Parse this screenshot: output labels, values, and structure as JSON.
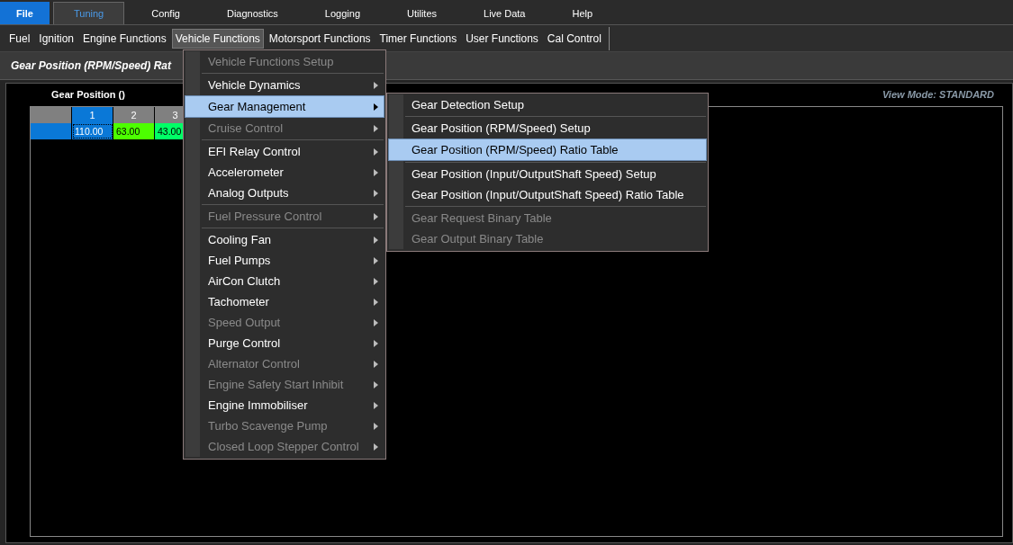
{
  "tabs": [
    {
      "label": "File",
      "kind": "file",
      "selected": false
    },
    {
      "label": "Tuning",
      "kind": "tab",
      "selected": true
    },
    {
      "label": "Config",
      "kind": "tab",
      "selected": false
    },
    {
      "label": "Diagnostics",
      "kind": "tab",
      "selected": false
    },
    {
      "label": "Logging",
      "kind": "tab",
      "selected": false
    },
    {
      "label": "Utilites",
      "kind": "tab",
      "selected": false
    },
    {
      "label": "Live Data",
      "kind": "tab",
      "selected": false
    },
    {
      "label": "Help",
      "kind": "tab",
      "selected": false
    }
  ],
  "menu_bar": [
    {
      "label": "Fuel",
      "selected": false
    },
    {
      "label": "Ignition",
      "selected": false
    },
    {
      "label": "Engine Functions",
      "selected": false
    },
    {
      "label": "Vehicle Functions",
      "selected": true
    },
    {
      "label": "Motorsport Functions",
      "selected": false
    },
    {
      "label": "Timer Functions",
      "selected": false
    },
    {
      "label": "User Functions",
      "selected": false
    },
    {
      "label": "Cal Control",
      "selected": false
    }
  ],
  "panel": {
    "title": "Gear Position (RPM/Speed) Rat",
    "view_mode": "View Mode: STANDARD",
    "table": {
      "title": "Gear Position ()",
      "columns": [
        {
          "label": "1",
          "selected": true
        },
        {
          "label": "2",
          "selected": false
        },
        {
          "label": "3",
          "selected": false
        }
      ],
      "cells": [
        {
          "value": "110.00",
          "color": "#0a78d7",
          "selected": true
        },
        {
          "value": "63.00",
          "color": "#4cff00",
          "selected": false
        },
        {
          "value": "43.00",
          "color": "#00ff66",
          "selected": false
        }
      ]
    }
  },
  "menu": [
    {
      "label": "Vehicle Functions Setup",
      "disabled": true,
      "submenu": false,
      "selected": false,
      "separator_after": true
    },
    {
      "label": "Vehicle Dynamics",
      "disabled": false,
      "submenu": true,
      "selected": false,
      "separator_after": false
    },
    {
      "label": "Gear Management",
      "disabled": false,
      "submenu": true,
      "selected": true,
      "separator_after": false
    },
    {
      "label": "Cruise Control",
      "disabled": true,
      "submenu": true,
      "selected": false,
      "separator_after": true
    },
    {
      "label": "EFI Relay Control",
      "disabled": false,
      "submenu": true,
      "selected": false,
      "separator_after": false
    },
    {
      "label": "Accelerometer",
      "disabled": false,
      "submenu": true,
      "selected": false,
      "separator_after": false
    },
    {
      "label": "Analog Outputs",
      "disabled": false,
      "submenu": true,
      "selected": false,
      "separator_after": true
    },
    {
      "label": "Fuel Pressure Control",
      "disabled": true,
      "submenu": true,
      "selected": false,
      "separator_after": true
    },
    {
      "label": "Cooling Fan",
      "disabled": false,
      "submenu": true,
      "selected": false,
      "separator_after": false
    },
    {
      "label": "Fuel Pumps",
      "disabled": false,
      "submenu": true,
      "selected": false,
      "separator_after": false
    },
    {
      "label": "AirCon Clutch",
      "disabled": false,
      "submenu": true,
      "selected": false,
      "separator_after": false
    },
    {
      "label": "Tachometer",
      "disabled": false,
      "submenu": true,
      "selected": false,
      "separator_after": false
    },
    {
      "label": "Speed Output",
      "disabled": true,
      "submenu": true,
      "selected": false,
      "separator_after": false
    },
    {
      "label": "Purge Control",
      "disabled": false,
      "submenu": true,
      "selected": false,
      "separator_after": false
    },
    {
      "label": "Alternator Control",
      "disabled": true,
      "submenu": true,
      "selected": false,
      "separator_after": false
    },
    {
      "label": "Engine Safety Start Inhibit",
      "disabled": true,
      "submenu": true,
      "selected": false,
      "separator_after": false
    },
    {
      "label": "Engine Immobiliser",
      "disabled": false,
      "submenu": true,
      "selected": false,
      "separator_after": false
    },
    {
      "label": "Turbo Scavenge Pump",
      "disabled": true,
      "submenu": true,
      "selected": false,
      "separator_after": false
    },
    {
      "label": "Closed Loop Stepper Control",
      "disabled": true,
      "submenu": true,
      "selected": false,
      "separator_after": false
    }
  ],
  "submenu": [
    {
      "label": "Gear Detection Setup",
      "disabled": false,
      "selected": false,
      "separator_after": true
    },
    {
      "label": "Gear Position (RPM/Speed) Setup",
      "disabled": false,
      "selected": false,
      "separator_after": false
    },
    {
      "label": "Gear Position (RPM/Speed) Ratio Table",
      "disabled": false,
      "selected": true,
      "separator_after": true
    },
    {
      "label": "Gear Position (Input/OutputShaft Speed) Setup",
      "disabled": false,
      "selected": false,
      "separator_after": false
    },
    {
      "label": "Gear Position (Input/OutputShaft Speed) Ratio Table",
      "disabled": false,
      "selected": false,
      "separator_after": true
    },
    {
      "label": "Gear Request Binary Table",
      "disabled": true,
      "selected": false,
      "separator_after": false
    },
    {
      "label": "Gear Output Binary Table",
      "disabled": true,
      "selected": false,
      "separator_after": false
    }
  ]
}
